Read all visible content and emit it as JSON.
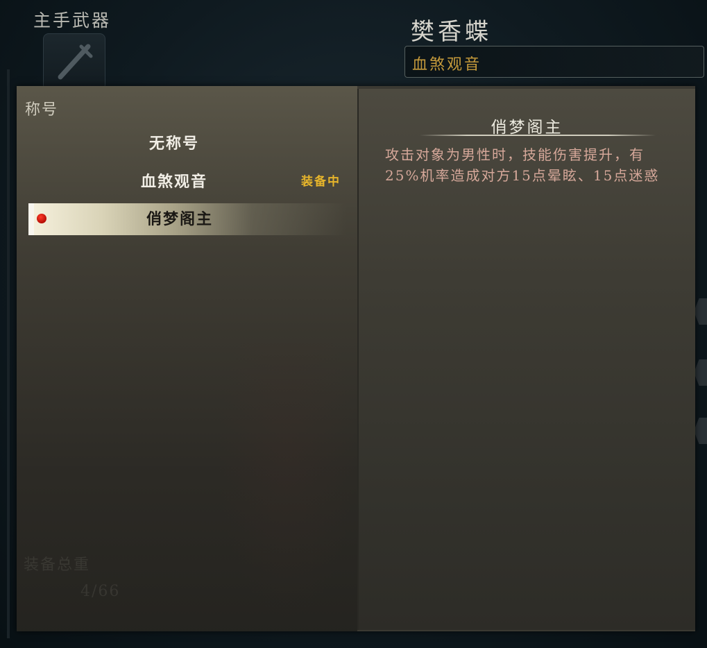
{
  "background": {
    "weapon_label": "主手武器",
    "character_name": "樊香蝶",
    "current_title": "血煞观音",
    "ghost": {
      "weight_label": "装备总重",
      "weight_value": "4/66"
    }
  },
  "title_panel": {
    "heading": "称号",
    "items": [
      {
        "label": "无称号",
        "status": ""
      },
      {
        "label": "血煞观音",
        "status": "装备中"
      },
      {
        "label": "俏梦阁主",
        "status": ""
      }
    ],
    "selected_index": 2
  },
  "detail": {
    "title": "俏梦阁主",
    "description": "攻击对象为男性时，技能伤害提升，有25%机率造成对方15点晕眩、15点迷惑"
  },
  "colors": {
    "equipped_badge": "#e7b52b",
    "description_text": "#d6a89a",
    "current_title_text": "#c59a3b",
    "selected_dot": "#c41a0c"
  },
  "icons": {
    "weapon_slot": "sword-icon",
    "selection_marker": "red-dot-icon"
  }
}
